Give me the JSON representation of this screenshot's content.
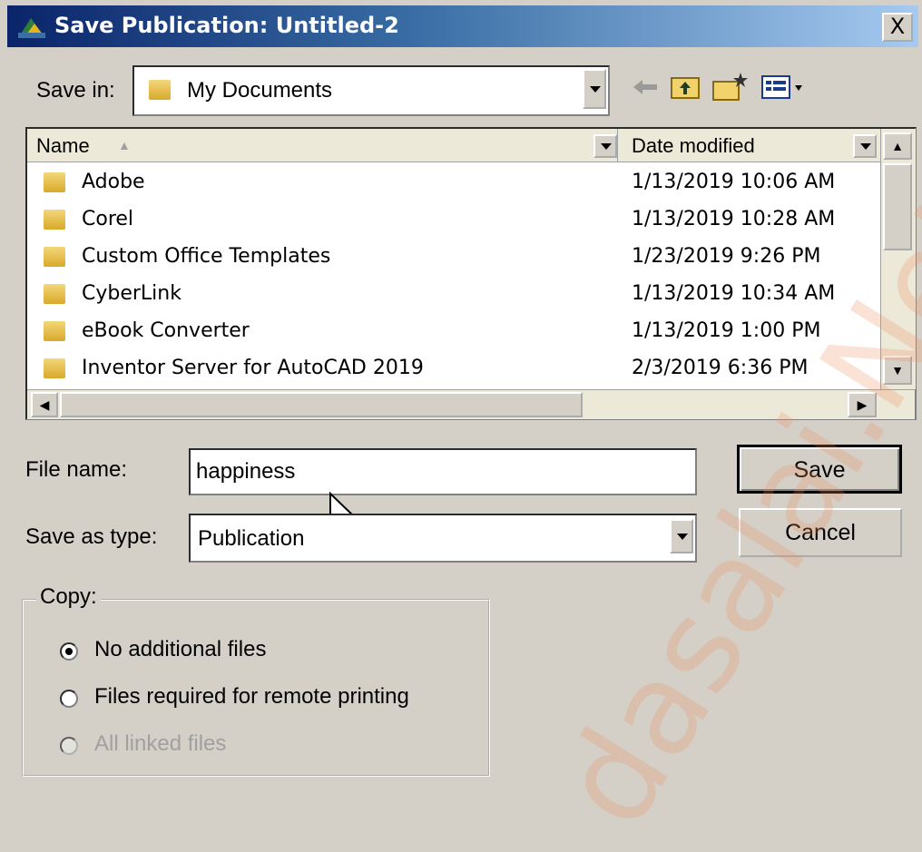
{
  "window": {
    "title": "Save Publication: Untitled-2",
    "close_label": "X"
  },
  "save_in": {
    "label": "Save in:",
    "value": "My Documents"
  },
  "list": {
    "col_name": "Name",
    "col_date": "Date modified",
    "files": [
      {
        "name": "Adobe",
        "date": "1/13/2019 10:06 AM"
      },
      {
        "name": "Corel",
        "date": "1/13/2019 10:28 AM"
      },
      {
        "name": "Custom Office Templates",
        "date": "1/23/2019 9:26 PM"
      },
      {
        "name": "CyberLink",
        "date": "1/13/2019 10:34 AM"
      },
      {
        "name": "eBook Converter",
        "date": "1/13/2019 1:00 PM"
      },
      {
        "name": "Inventor Server for AutoCAD 2019",
        "date": "2/3/2019 6:36 PM"
      }
    ]
  },
  "form": {
    "file_name_label": "File name:",
    "file_name_value": "happiness",
    "type_label": "Save as type:",
    "type_value": "Publication",
    "save_label": "Save",
    "cancel_label": "Cancel"
  },
  "copy": {
    "legend": "Copy:",
    "options": [
      {
        "label": "No additional files",
        "checked": true,
        "enabled": true
      },
      {
        "label": "Files required for remote printing",
        "checked": false,
        "enabled": true
      },
      {
        "label": "All linked files",
        "checked": false,
        "enabled": false
      }
    ]
  },
  "watermark": "dasalai.Net"
}
